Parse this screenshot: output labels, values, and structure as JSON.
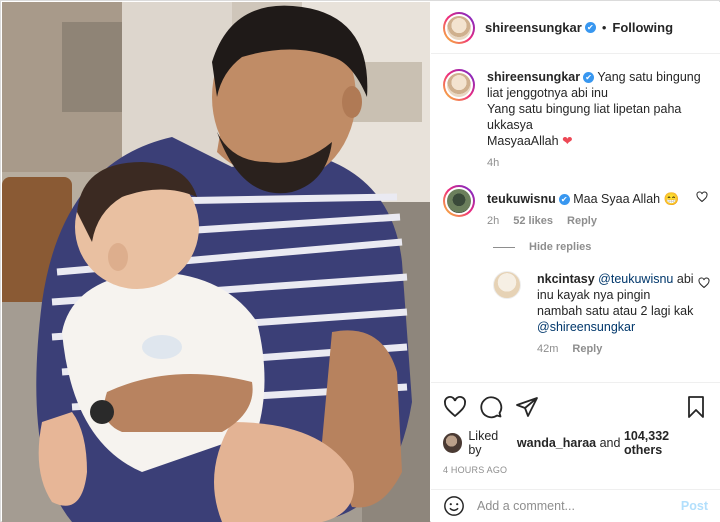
{
  "header": {
    "username": "shireensungkar",
    "verified_glyph": "✔",
    "separator": "•",
    "follow_label": "Following"
  },
  "caption": {
    "username": "shireensungkar",
    "text_lines": [
      "Yang satu bingung",
      "liat jenggotnya abi inu",
      "Yang satu bingung liat lipetan paha",
      "ukkasya",
      "MasyaaAllah"
    ],
    "emoji": "❤",
    "time": "4h"
  },
  "comments": [
    {
      "username": "teukuwisnu",
      "text": "Maa Syaa Allah",
      "emoji": "😁",
      "time": "2h",
      "likes": "52 likes",
      "reply": "Reply"
    }
  ],
  "hide_replies": "Hide replies",
  "reply": {
    "username": "nkcintasy",
    "mention1": "@teukuwisnu",
    "text_lines": [
      "abi",
      "inu kayak nya pingin",
      "nambah satu atau 2 lagi",
      "kak"
    ],
    "mention2": "@shireensungkar",
    "time": "42m",
    "reply": "Reply"
  },
  "likes": {
    "prefix": "Liked by",
    "user": "wanda_haraa",
    "and": "and",
    "count": "104,332 others"
  },
  "timestamp": "4 HOURS AGO",
  "add_comment": {
    "placeholder": "Add a comment...",
    "post_label": "Post"
  },
  "icons": [
    "heart-icon",
    "comment-icon",
    "share-icon",
    "bookmark-icon",
    "emoji-icon"
  ],
  "colors": {
    "verified": "#3897f0",
    "link": "#00376b",
    "muted": "#8e8e8e",
    "post": "#b2dffc",
    "heart": "#ed4956"
  }
}
